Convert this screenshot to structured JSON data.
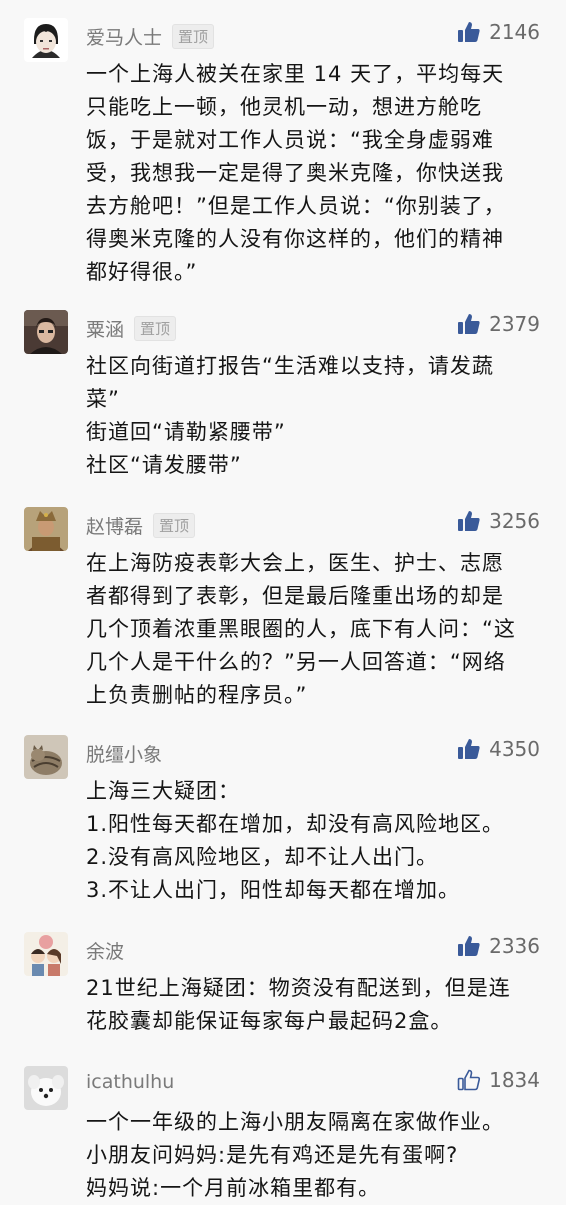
{
  "pin_label": "置顶",
  "comments": [
    {
      "user": "爱马人士",
      "pinned": true,
      "likes": "2146",
      "like_icon": "thumbs-up-filled",
      "lines": [
        "一个上海人被关在家里 14 天了，平均每天",
        "只能吃上一顿，他灵机一动，想进方舱吃",
        "饭，于是就对工作人员说：“我全身虚弱难",
        "受，我想我一定是得了奥米克隆，你快送我",
        "去方舱吧！”但是工作人员说：“你别装了，",
        "得奥米克隆的人没有你这样的，他们的精神",
        "都好得很。”"
      ]
    },
    {
      "user": "粟涵",
      "pinned": true,
      "likes": "2379",
      "like_icon": "thumbs-up-filled",
      "lines": [
        "社区向街道打报告“生活难以支持，请发蔬",
        "菜”",
        "街道回“请勒紧腰带”",
        "社区“请发腰带”"
      ]
    },
    {
      "user": "赵博磊",
      "pinned": true,
      "likes": "3256",
      "like_icon": "thumbs-up-filled",
      "lines": [
        "在上海防疫表彰大会上，医生、护士、志愿",
        "者都得到了表彰，但是最后隆重出场的却是",
        "几个顶着浓重黑眼圈的人，底下有人问：“这",
        "几个人是干什么的？”另一人回答道：“网络",
        "上负责删帖的程序员。”"
      ]
    },
    {
      "user": "脱缰小象",
      "pinned": false,
      "likes": "4350",
      "like_icon": "thumbs-up-filled",
      "lines": [
        "上海三大疑团：",
        "1.阳性每天都在增加，却没有高风险地区。",
        "2.没有高风险地区，却不让人出门。",
        "3.不让人出门，阳性却每天都在增加。"
      ]
    },
    {
      "user": "余波",
      "pinned": false,
      "likes": "2336",
      "like_icon": "thumbs-up-filled",
      "lines": [
        "21世纪上海疑团：物资没有配送到，但是连",
        "花胶囊却能保证每家每户最起码2盒。"
      ]
    },
    {
      "user": "icathulhu",
      "pinned": false,
      "likes": "1834",
      "like_icon": "thumbs-up-outline",
      "lines": [
        "一个一年级的上海小朋友隔离在家做作业。",
        "小朋友问妈妈:是先有鸡还是先有蛋啊?",
        "妈妈说:一个月前冰箱里都有。"
      ]
    }
  ]
}
